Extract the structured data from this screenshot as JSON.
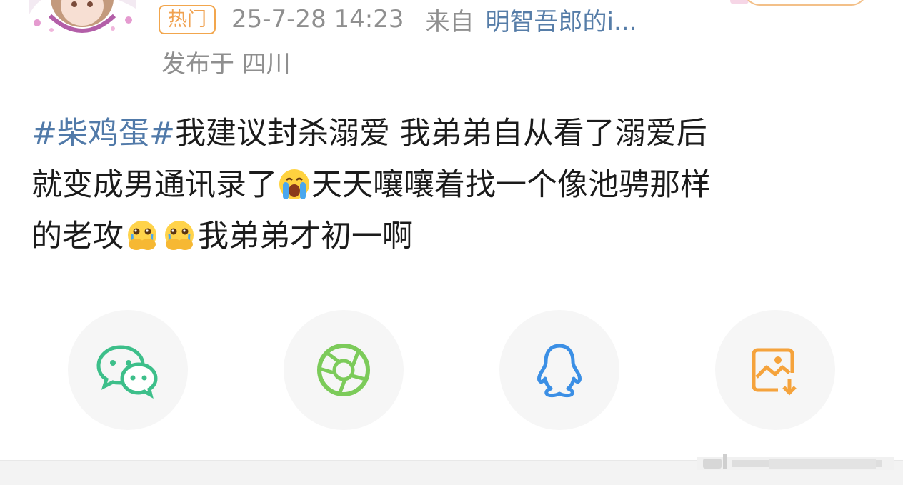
{
  "post": {
    "badge": "热门",
    "time": "25-7-28 14:23",
    "from_label": "来自",
    "source": "明智吾郎的i...",
    "location": "发布于 四川",
    "text": {
      "hashtag": "#柴鸡蛋#",
      "line1": "我建议封杀溺爱 我弟弟自从看了溺爱后",
      "line2a": "就变成男通讯录了",
      "line2b": "天天嚷嚷着找一个像池骋那样",
      "line3a": "的老攻",
      "line3b": "我弟弟才初一啊"
    },
    "emojis": [
      "crying-face-emoji",
      "covering-mouth-crying-emoji",
      "covering-mouth-crying-emoji"
    ]
  },
  "share": {
    "items": [
      {
        "icon": "wechat-icon",
        "color": "#3dbf8a"
      },
      {
        "icon": "moments-aperture-icon",
        "color": "#7ccb5a"
      },
      {
        "icon": "qq-penguin-icon",
        "color": "#3b8fe5"
      },
      {
        "icon": "save-image-icon",
        "color": "#f5a33c"
      }
    ]
  },
  "colors": {
    "link": "#517aa9",
    "badge": "#f0a14f",
    "meta": "#8f8f8f"
  }
}
